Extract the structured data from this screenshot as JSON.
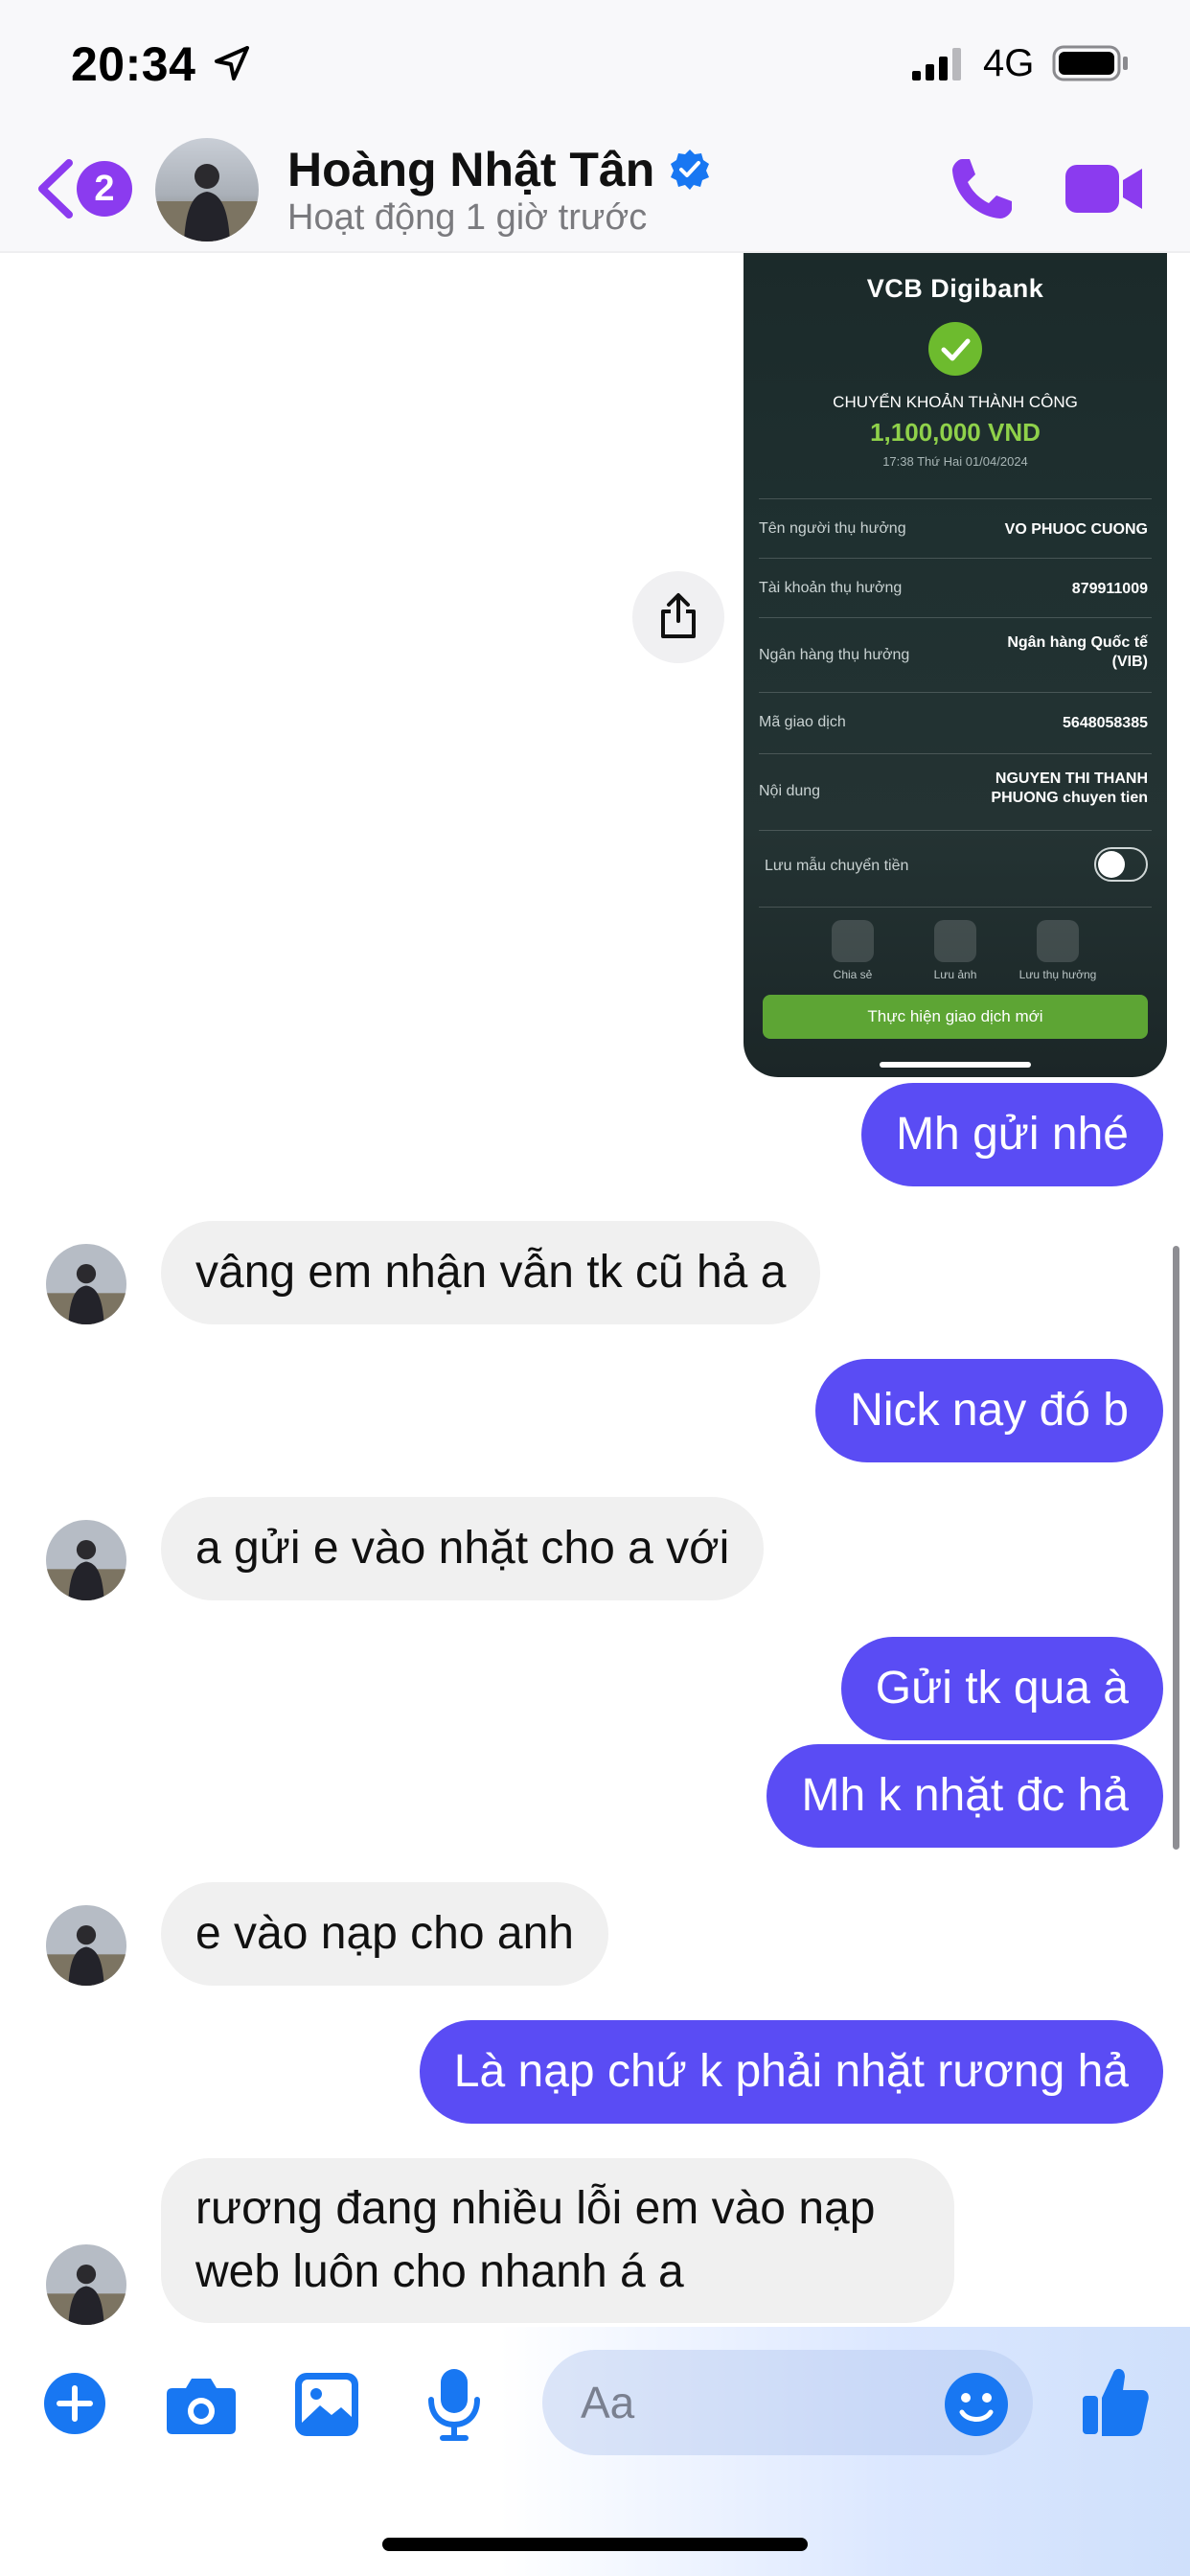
{
  "status_bar": {
    "time": "20:34",
    "network": "4G",
    "icons": [
      "location-arrow-icon",
      "signal-bars-icon",
      "battery-icon"
    ]
  },
  "header": {
    "back_badge": "2",
    "contact_name": "Hoàng Nhật Tân",
    "contact_status": "Hoạt động 1 giờ trước",
    "verified": true,
    "icons": [
      "back-chevron-icon",
      "verified-icon",
      "phone-icon",
      "video-camera-icon"
    ],
    "accent_color": "#8b3bef"
  },
  "receipt": {
    "logo": "VCB Digibank",
    "heading": "CHUYỂN KHOẢN THÀNH CÔNG",
    "amount": "1,100,000 VND",
    "datetime": "17:38 Thứ Hai 01/04/2024",
    "rows": [
      {
        "label": "Tên người thụ hưởng",
        "value": "VO PHUOC CUONG"
      },
      {
        "label": "Tài khoản thụ hưởng",
        "value": "879911009"
      },
      {
        "label": "Ngân hàng thụ hưởng",
        "value": "Ngân hàng  Quốc tế (VIB)"
      },
      {
        "label": "Mã giao dịch",
        "value": "5648058385"
      },
      {
        "label": "Nội dung",
        "value": "NGUYEN THI THANH PHUONG chuyen tien"
      }
    ],
    "save_template_label": "Lưu mẫu chuyển tiền",
    "save_template_on": false,
    "actions": [
      "Chia sẻ",
      "Lưu ảnh",
      "Lưu thụ hưởng"
    ],
    "cta": "Thực hiện giao dịch mới"
  },
  "messages": [
    {
      "direction": "out",
      "text": "Mh gửi nhé"
    },
    {
      "direction": "in",
      "text": "vâng em nhận vẫn tk cũ hả a"
    },
    {
      "direction": "out",
      "text": "Nick nay đó b"
    },
    {
      "direction": "in",
      "text": "a gửi e vào nhặt cho a với"
    },
    {
      "direction": "out",
      "text": "Gửi tk qua à"
    },
    {
      "direction": "out",
      "text": "Mh k nhặt đc hả"
    },
    {
      "direction": "in",
      "text": "e vào nạp cho anh"
    },
    {
      "direction": "out",
      "text": "Là nạp chứ k phải nhặt rương hả"
    },
    {
      "direction": "in",
      "text": "rương đang nhiều lỗi em vào nạp web luôn cho nhanh á a"
    }
  ],
  "composer": {
    "placeholder": "Aa",
    "icons": [
      "plus-icon",
      "camera-icon",
      "photo-icon",
      "microphone-icon",
      "emoji-icon",
      "thumbs-up-icon"
    ],
    "accent_color": "#1877f2"
  },
  "colors": {
    "outgoing_bubble": "#5a4cf4",
    "incoming_bubble": "#f0f0f0"
  }
}
